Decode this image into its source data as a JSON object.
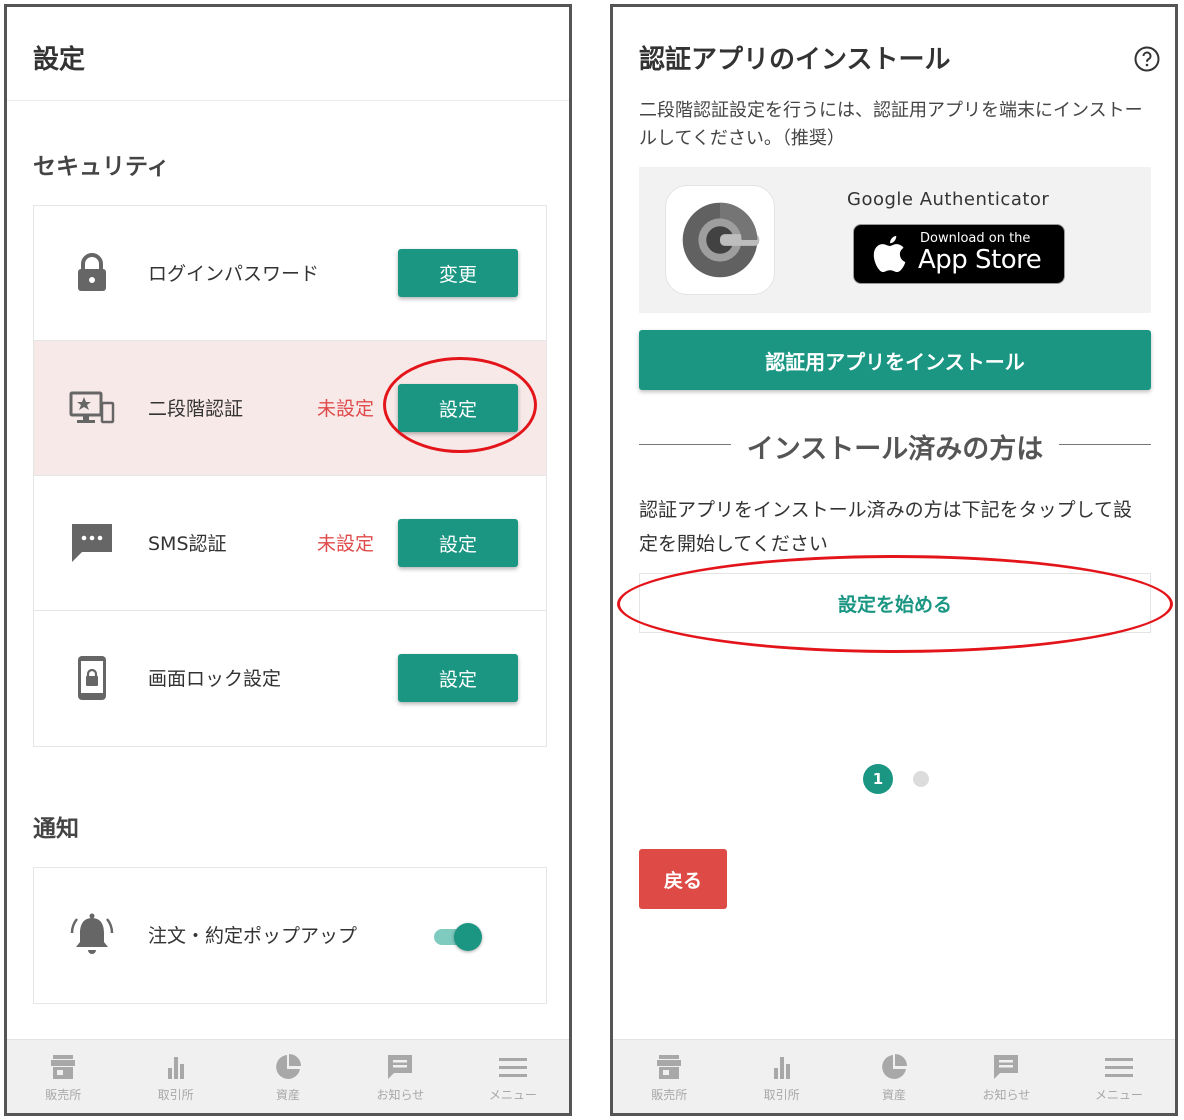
{
  "left": {
    "header_title": "設定",
    "security_title": "セキュリティ",
    "rows": [
      {
        "label": "ログインパスワード",
        "status": "",
        "button": "変更",
        "icon": "lock-icon"
      },
      {
        "label": "二段階認証",
        "status": "未設定",
        "button": "設定",
        "icon": "two-factor-device-icon"
      },
      {
        "label": "SMS認証",
        "status": "未設定",
        "button": "設定",
        "icon": "sms-message-icon"
      },
      {
        "label": "画面ロック設定",
        "status": "",
        "button": "設定",
        "icon": "phone-lock-icon"
      }
    ],
    "notify_title": "通知",
    "notify_rows": [
      {
        "label": "注文・約定ポップアップ",
        "toggle_on": true,
        "icon": "bell-icon"
      }
    ]
  },
  "right": {
    "title": "認証アプリのインストール",
    "description": "二段階認証設定を行うには、認証用アプリを端末にインストールしてください。（推奨）",
    "app_name": "Google Authenticator",
    "appstore_line1": "Download on the",
    "appstore_line2": "App Store",
    "install_button": "認証用アプリをインストール",
    "divider_text": "インストール済みの方は",
    "description2": "認証アプリをインストール済みの方は下記をタップして設定を開始してください",
    "start_button": "設定を始める",
    "pagination_current": "1",
    "back_button": "戻る"
  },
  "tabbar": [
    {
      "label": "販売所",
      "icon": "store-icon"
    },
    {
      "label": "取引所",
      "icon": "bar-chart-icon"
    },
    {
      "label": "資産",
      "icon": "pie-chart-icon"
    },
    {
      "label": "お知らせ",
      "icon": "message-icon"
    },
    {
      "label": "メニュー",
      "icon": "menu-icon"
    }
  ],
  "colors": {
    "accent": "#1a9683",
    "warning": "#e04a4a",
    "highlight_row": "#f8e9e9",
    "back_button": "#de4b46",
    "annotation": "#e3151a"
  }
}
